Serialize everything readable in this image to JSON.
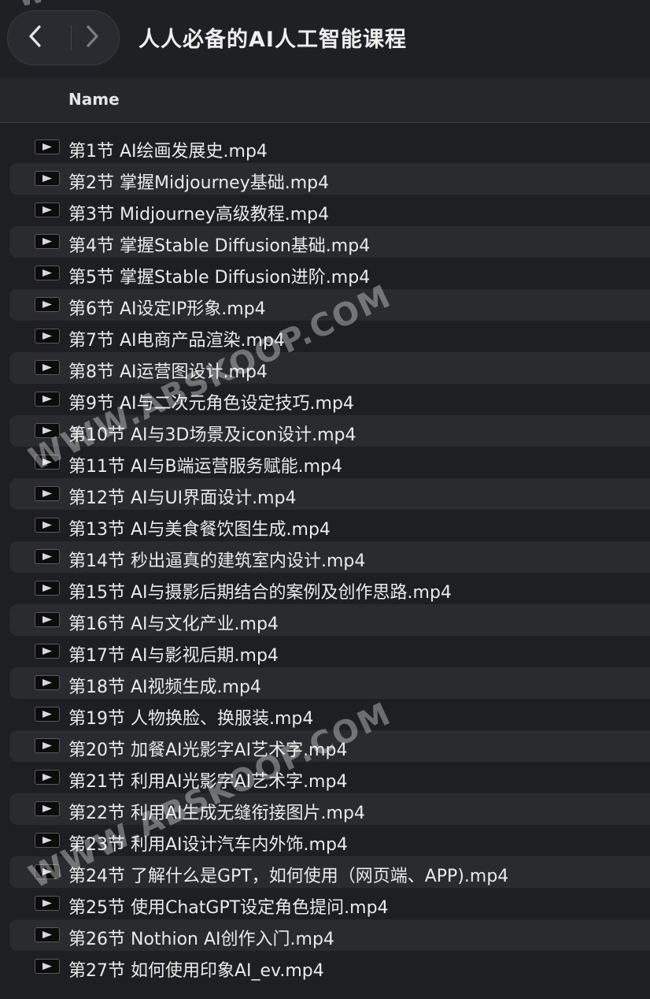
{
  "window": {
    "title": "人人必备的AI人工智能课程"
  },
  "toolbar": {
    "back_icon": "chevron-left-icon",
    "forward_icon": "chevron-right-icon"
  },
  "list_header": {
    "name_column": "Name"
  },
  "files": [
    {
      "name": "第1节 AI绘画发展史.mp4"
    },
    {
      "name": "第2节 掌握Midjourney基础.mp4"
    },
    {
      "name": "第3节 Midjourney高级教程.mp4"
    },
    {
      "name": "第4节 掌握Stable Diffusion基础.mp4"
    },
    {
      "name": "第5节 掌握Stable Diffusion进阶.mp4"
    },
    {
      "name": "第6节 AI设定IP形象.mp4"
    },
    {
      "name": "第7节 AI电商产品渲染.mp4"
    },
    {
      "name": "第8节 AI运营图设计.mp4"
    },
    {
      "name": "第9节 AI与二次元角色设定技巧.mp4"
    },
    {
      "name": "第10节 AI与3D场景及icon设计.mp4"
    },
    {
      "name": "第11节 AI与B端运营服务赋能.mp4"
    },
    {
      "name": "第12节 AI与UI界面设计.mp4"
    },
    {
      "name": "第13节 AI与美食餐饮图生成.mp4"
    },
    {
      "name": "第14节 秒出逼真的建筑室内设计.mp4"
    },
    {
      "name": "第15节 AI与摄影后期结合的案例及创作思路.mp4"
    },
    {
      "name": "第16节 AI与文化产业.mp4"
    },
    {
      "name": "第17节 AI与影视后期.mp4"
    },
    {
      "name": "第18节 AI视频生成.mp4"
    },
    {
      "name": "第19节 人物换脸、换服装.mp4"
    },
    {
      "name": "第20节 加餐AI光影字AI艺术字.mp4"
    },
    {
      "name": "第21节 利用AI光影字AI艺术字.mp4"
    },
    {
      "name": "第22节 利用AI生成无缝衔接图片.mp4"
    },
    {
      "name": "第23节 利用AI设计汽车内外饰.mp4"
    },
    {
      "name": "第24节 了解什么是GPT，如何使用（网页端、APP).mp4"
    },
    {
      "name": "第25节 使用ChatGPT设定角色提问.mp4"
    },
    {
      "name": "第26节 Nothion AI创作入门.mp4"
    },
    {
      "name": "第27节 如何使用印象AI_ev.mp4"
    }
  ],
  "watermarks": [
    "WWW.ABSKOOP.COM",
    "WWW.ABSKOOP.COM",
    "W"
  ],
  "colors": {
    "background": "#1e1f23",
    "row_alt": "#2a2b2f",
    "text": "#eaeaea"
  }
}
